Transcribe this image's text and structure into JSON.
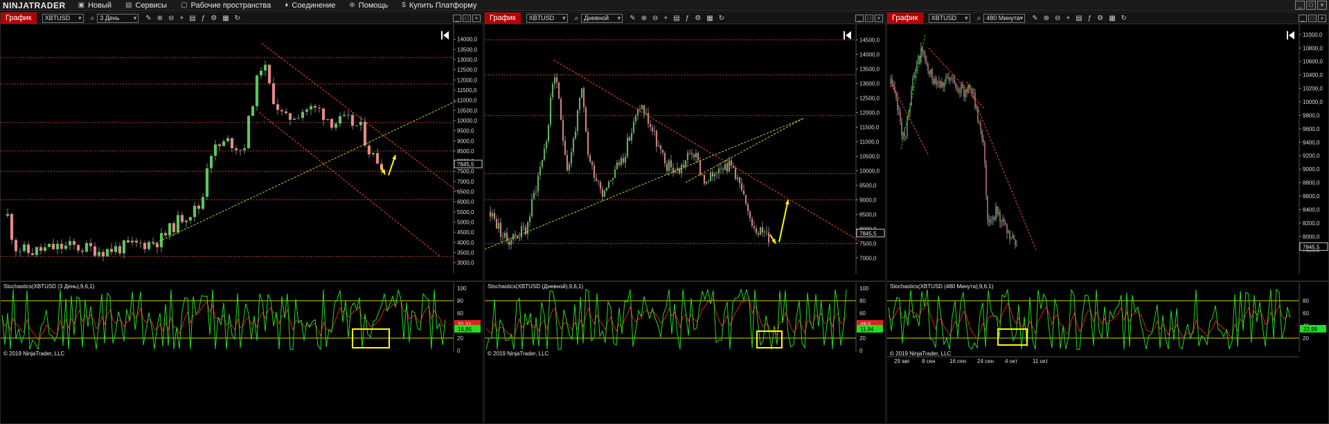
{
  "app": {
    "logo_part1": "NINJA",
    "logo_part2": "TRADER",
    "menu": [
      {
        "label": "Новый",
        "icon": "new-icon",
        "glyph": "▣"
      },
      {
        "label": "Сервисы",
        "icon": "services-icon",
        "glyph": "▤"
      },
      {
        "label": "Рабочие пространства",
        "icon": "workspace-icon",
        "glyph": "▢"
      },
      {
        "label": "Соединение",
        "icon": "connection-icon",
        "glyph": "♦"
      },
      {
        "label": "Помощь",
        "icon": "help-icon",
        "glyph": "⊕"
      },
      {
        "label": "Купить Платформу",
        "icon": "buy-icon",
        "glyph": "$"
      }
    ],
    "window_controls": [
      "_",
      "□",
      "×"
    ]
  },
  "panels": [
    {
      "tab": "График",
      "instrument": "XBTUSD",
      "interval": "3 День",
      "last_price": "7845,5",
      "price_ticks": [
        "14000,0",
        "13500,0",
        "13000,0",
        "12500,0",
        "12000,0",
        "11500,0",
        "11000,0",
        "10500,0",
        "10000,0",
        "9500,0",
        "9000,0",
        "8500,0",
        "8000,0",
        "7500,0",
        "7000,0",
        "6500,0",
        "6000,0",
        "5500,0",
        "5000,0",
        "4500,0",
        "4000,0",
        "3500,0",
        "3000,0"
      ],
      "indicator_label": "Stochastics(XBTUSD (3 День),9,6,1)",
      "stoch_ticks": [
        "100",
        "80",
        "60",
        "40",
        "20",
        "0"
      ],
      "stoch_d_value": "31,11",
      "stoch_k_value": "16,85",
      "copyright": "© 2019 NinjaTrader, LLC",
      "time_ticks": []
    },
    {
      "tab": "График",
      "instrument": "XBTUSD",
      "interval": "Дневной",
      "last_price": "7845,5",
      "price_ticks": [
        "14500,0",
        "14000,0",
        "13500,0",
        "13000,0",
        "12500,0",
        "12000,0",
        "11500,0",
        "11000,0",
        "10500,0",
        "10000,0",
        "9500,0",
        "9000,0",
        "8500,0",
        "8000,0",
        "7500,0",
        "7000,0"
      ],
      "indicator_label": "Stochastics(XBTUSD (Дневной),9,6,1)",
      "stoch_ticks": [
        "100",
        "80",
        "60",
        "40",
        "20",
        "0"
      ],
      "stoch_d_value": "48,5",
      "stoch_k_value": "11,94",
      "copyright": "© 2019 NinjaTrader, LLC",
      "time_ticks": []
    },
    {
      "tab": "График",
      "instrument": "XBTUSD",
      "interval": "480 Минута",
      "last_price": "7845,5",
      "price_ticks": [
        "11000,0",
        "10800,0",
        "10600,0",
        "10400,0",
        "10200,0",
        "10000,0",
        "9800,0",
        "9600,0",
        "9400,0",
        "9200,0",
        "9000,0",
        "8800,0",
        "8600,0",
        "8400,0",
        "8200,0",
        "8000,0",
        "7800,0"
      ],
      "indicator_label": "Stochastics(XBTUSD (480 Минута),9,6,1)",
      "stoch_ticks": [
        "80",
        "60",
        "40",
        "20"
      ],
      "stoch_d_value": "",
      "stoch_k_value": "22,99",
      "copyright": "© 2019 NinjaTrader, LLC",
      "time_ticks": [
        "29 авг",
        "8 сен",
        "16 сен",
        "24 сен",
        "4 окт",
        "11 окт"
      ]
    }
  ],
  "colors": {
    "bull_candle": "#5cc95c",
    "bear_candle": "#e88a8a",
    "level_line": "#c83a2a",
    "trend_down": "#ff4a2a",
    "trend_up": "#b8e020",
    "stoch_k": "#22dd22",
    "stoch_d": "#dd2222",
    "stoch_level": "#d6d600",
    "highlight": "#ffff00",
    "last_price_box": "#ffffff"
  }
}
